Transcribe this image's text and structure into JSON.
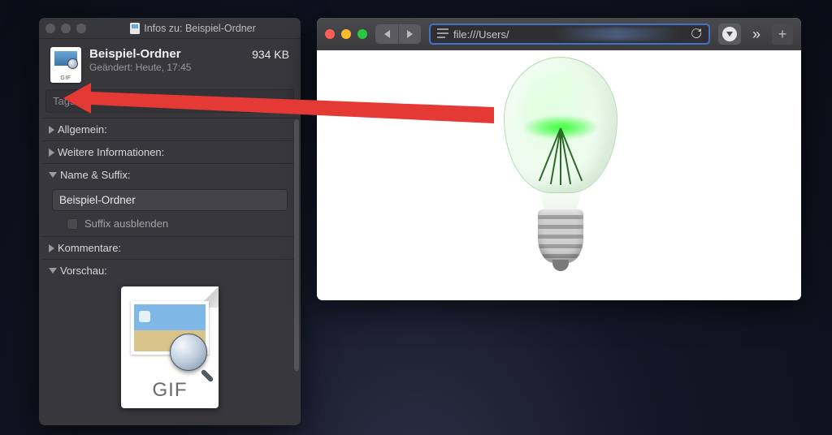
{
  "info": {
    "window_title": "Infos zu: Beispiel-Ordner",
    "file_name": "Beispiel-Ordner",
    "modified": "Geändert: Heute, 17:45",
    "size": "934 KB",
    "tags_placeholder": "Tags …",
    "sections": {
      "general": "Allgemein:",
      "more_info": "Weitere Informationen:",
      "name_suffix": "Name & Suffix:",
      "comments": "Kommentare:",
      "preview": "Vorschau:"
    },
    "name_value": "Beispiel-Ordner",
    "suffix_hide": "Suffix ausblenden",
    "thumb_ext": "GIF"
  },
  "browser": {
    "url": "file:///Users/",
    "colors": {
      "close": "#ff5f57",
      "min": "#febc2e",
      "zoom": "#28c840"
    }
  },
  "annotation": {
    "color": "#e53935"
  }
}
